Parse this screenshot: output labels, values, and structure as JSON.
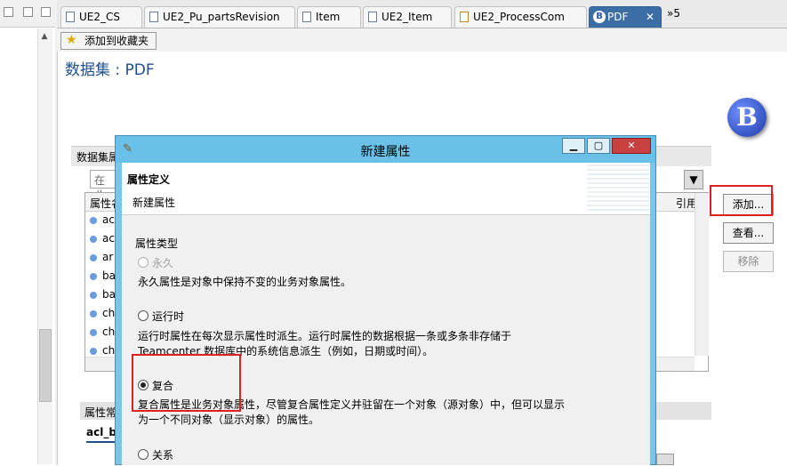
{
  "tabs": [
    {
      "label": "UE2_CS"
    },
    {
      "label": "UE2_Pu_partsRevision"
    },
    {
      "label": "Item"
    },
    {
      "label": "UE2_Item"
    },
    {
      "label": "UE2_ProcessCom"
    },
    {
      "label": "PDF",
      "close": "✕"
    }
  ],
  "tab_overflow": "»5",
  "toolbar": {
    "favorite_label": "添加到收藏夹"
  },
  "page": {
    "title": "数据集 : PDF",
    "logo_letter": "B"
  },
  "dataset": {
    "header_label": "数据集属",
    "filter_placeholder": "在此",
    "columns": {
      "name": "属性名",
      "ref": "引用"
    },
    "rows": [
      {
        "name": "ac"
      },
      {
        "name": "ac"
      },
      {
        "name": "ar"
      },
      {
        "name": "ba"
      },
      {
        "name": "ba"
      },
      {
        "name": "ch"
      },
      {
        "name": "ch"
      },
      {
        "name": "ch"
      }
    ]
  },
  "buttons": {
    "add": "添加...",
    "view": "查看...",
    "remove": "移除"
  },
  "props": {
    "header_label": "属性常",
    "value": "acl_bi"
  },
  "dialog": {
    "title": "新建属性",
    "controls": {
      "minimize": "▁",
      "maximize": "▢",
      "close": "✕"
    },
    "section": "属性定义",
    "subtitle": "新建属性",
    "type_label": "属性类型",
    "options": [
      {
        "label": "永久",
        "desc": "永久属性是对象中保持不变的业务对象属性。",
        "disabled": true,
        "checked": false
      },
      {
        "label": "运行时",
        "desc": "运行时属性在每次显示属性时派生。运行时属性的数据根据一条或多条非存储于 Teamcenter 数据库中的系统信息派生（例如，日期或时间）。",
        "disabled": false,
        "checked": false
      },
      {
        "label": "复合",
        "desc": "复合属性是业务对象属性，尽管复合属性定义并驻留在一个对象（源对象）中，但可以显示为一个不同对象（显示对象）的属性。",
        "disabled": false,
        "checked": true
      },
      {
        "label": "关系",
        "desc": "",
        "disabled": false,
        "checked": false
      }
    ]
  },
  "colors": {
    "dialog_frame": "#7cc4e8",
    "highlight": "#e02020",
    "title_blue": "#1e4f8f"
  }
}
